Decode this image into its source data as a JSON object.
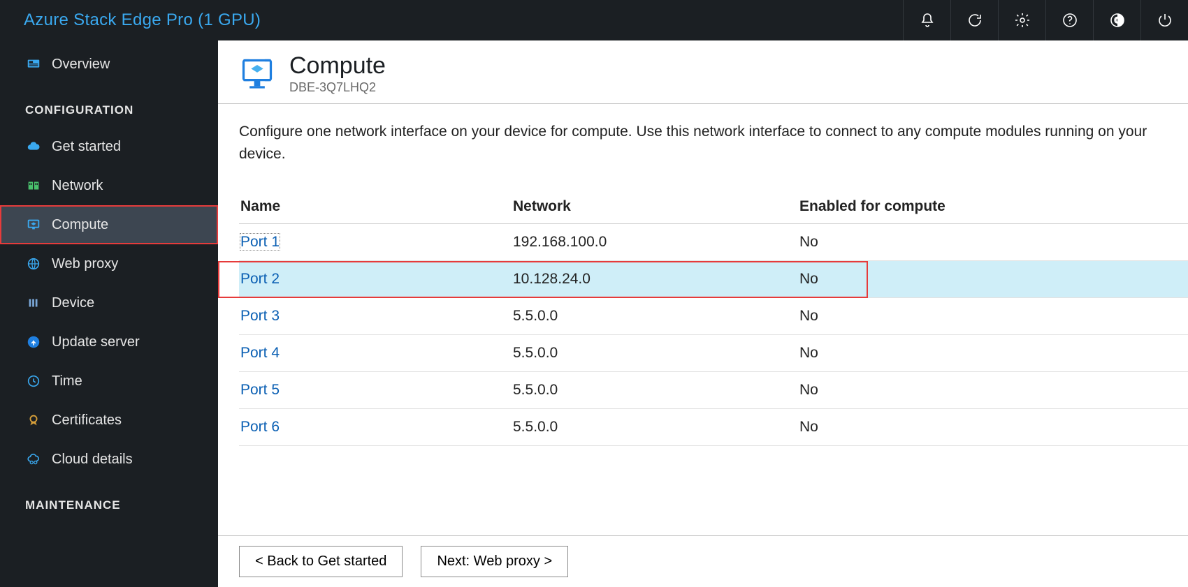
{
  "topbar": {
    "title": "Azure Stack Edge Pro (1 GPU)",
    "icons": {
      "bell": "notifications-icon",
      "refresh": "refresh-icon",
      "settings": "settings-icon",
      "help": "help-icon",
      "contrast": "contrast-icon",
      "power": "power-icon"
    }
  },
  "sidebar": {
    "overview": "Overview",
    "section_config": "CONFIGURATION",
    "items": [
      {
        "label": "Get started",
        "key": "get-started"
      },
      {
        "label": "Network",
        "key": "network"
      },
      {
        "label": "Compute",
        "key": "compute",
        "active": true
      },
      {
        "label": "Web proxy",
        "key": "web-proxy"
      },
      {
        "label": "Device",
        "key": "device"
      },
      {
        "label": "Update server",
        "key": "update-server"
      },
      {
        "label": "Time",
        "key": "time"
      },
      {
        "label": "Certificates",
        "key": "certificates"
      },
      {
        "label": "Cloud details",
        "key": "cloud-details"
      }
    ],
    "section_maint": "MAINTENANCE"
  },
  "main": {
    "title": "Compute",
    "subtitle": "DBE-3Q7LHQ2",
    "description": "Configure one network interface on your device for compute. Use this network interface to connect to any compute modules running on your device.",
    "table": {
      "headers": {
        "name": "Name",
        "network": "Network",
        "enabled": "Enabled for compute"
      },
      "rows": [
        {
          "name": "Port 1",
          "network": "192.168.100.0",
          "enabled": "No",
          "focus": true
        },
        {
          "name": "Port 2",
          "network": "10.128.24.0",
          "enabled": "No",
          "selected": true
        },
        {
          "name": "Port 3",
          "network": "5.5.0.0",
          "enabled": "No"
        },
        {
          "name": "Port 4",
          "network": "5.5.0.0",
          "enabled": "No"
        },
        {
          "name": "Port 5",
          "network": "5.5.0.0",
          "enabled": "No"
        },
        {
          "name": "Port 6",
          "network": "5.5.0.0",
          "enabled": "No"
        }
      ]
    },
    "footer": {
      "back": "<  Back to Get started",
      "next": "Next: Web proxy  >"
    }
  }
}
